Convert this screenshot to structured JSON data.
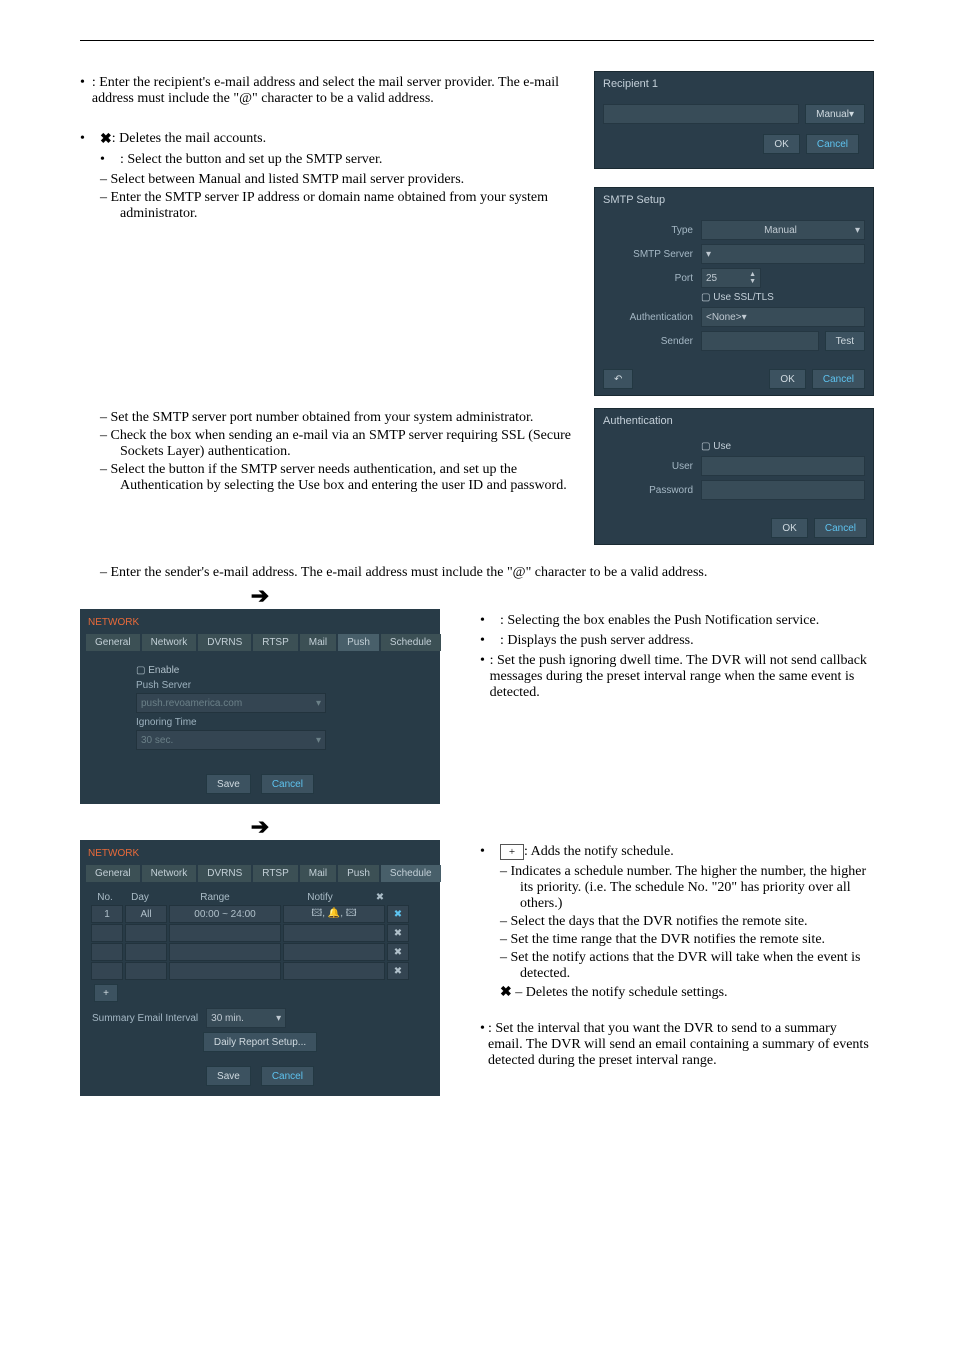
{
  "section1": {
    "b1": ": Enter the recipient's e-mail address and select the mail server provider. The e-mail address must include the \"@\" character to be a valid address.",
    "b2": ": Deletes the mail accounts.",
    "b3": ": Select the button and set up the SMTP server.",
    "s31": "– Select between Manual and listed SMTP mail server providers.",
    "s32": "– Enter the SMTP server IP address or domain name obtained from your system administrator.",
    "s33": "– Set the SMTP server port number obtained from your system administrator.",
    "s34": "– Check the box when sending an e-mail via an SMTP server requiring SSL (Secure Sockets Layer) authentication.",
    "s35": "– Select the button if the SMTP server needs authentication, and set up the Authentication by selecting the Use box and entering the user ID and password.",
    "s36": "– Enter the sender's e-mail address.  The e-mail address must include the \"@\" character to be a valid address."
  },
  "dlg_recipient": {
    "title": "Recipient 1",
    "manual": "Manual",
    "ok": "OK",
    "cancel": "Cancel"
  },
  "dlg_smtp": {
    "title": "SMTP Setup",
    "rows": {
      "type": "Type",
      "type_val": "Manual",
      "server": "SMTP Server",
      "port": "Port",
      "port_val": "25",
      "ssl": "Use SSL/TLS",
      "auth": "Authentication",
      "auth_val": "<None>",
      "sender": "Sender",
      "test": "Test"
    },
    "ok": "OK",
    "cancel": "Cancel"
  },
  "dlg_auth": {
    "title": "Authentication",
    "use": "Use",
    "user": "User",
    "password": "Password",
    "ok": "OK",
    "cancel": "Cancel"
  },
  "push_panel": {
    "heading": "NETWORK",
    "tabs": [
      "General",
      "Network",
      "DVRNS",
      "RTSP",
      "Mail",
      "Push",
      "Schedule"
    ],
    "enable": "Enable",
    "push_server_lbl": "Push Server",
    "push_server_val": "push.revoamerica.com",
    "ignoring_lbl": "Ignoring Time",
    "ignoring_val": "30 sec.",
    "save": "Save",
    "cancel": "Cancel"
  },
  "push_text": {
    "b1": ": Selecting the box enables the Push Notification service.",
    "b2": ": Displays the push server address.",
    "b3": ": Set the push ignoring dwell time.  The DVR will not send callback messages during the preset interval range when the same event is detected."
  },
  "sched_panel": {
    "heading": "NETWORK",
    "tabs": [
      "General",
      "Network",
      "DVRNS",
      "RTSP",
      "Mail",
      "Push",
      "Schedule"
    ],
    "headers": {
      "no": "No.",
      "day": "Day",
      "range": "Range",
      "notify": "Notify",
      "x": "✖"
    },
    "row": {
      "no": "1",
      "day": "All",
      "range": "00:00 ~ 24:00",
      "notify": "🖾, 🔔, 🖾"
    },
    "sum_label": "Summary Email Interval",
    "sum_val": "30 min.",
    "daily": "Daily Report Setup...",
    "save": "Save",
    "cancel": "Cancel"
  },
  "sched_text": {
    "b1": ":  Adds the notify schedule.",
    "s1": "– Indicates a schedule number.  The higher the number, the higher its priority. (i.e. The schedule No. \"20\" has priority over all others.)",
    "s2": "– Select the days that the DVR notifies the remote site.",
    "s3": "– Set the time range that the DVR notifies the remote site.",
    "s4": "– Set the notify actions that the DVR will take when the event is detected.",
    "s5": "– Deletes the notify schedule settings.",
    "b2": ": Set the interval that you want the DVR to send to a summary email.  The DVR will send an email containing a summary of events detected during the preset interval range."
  }
}
